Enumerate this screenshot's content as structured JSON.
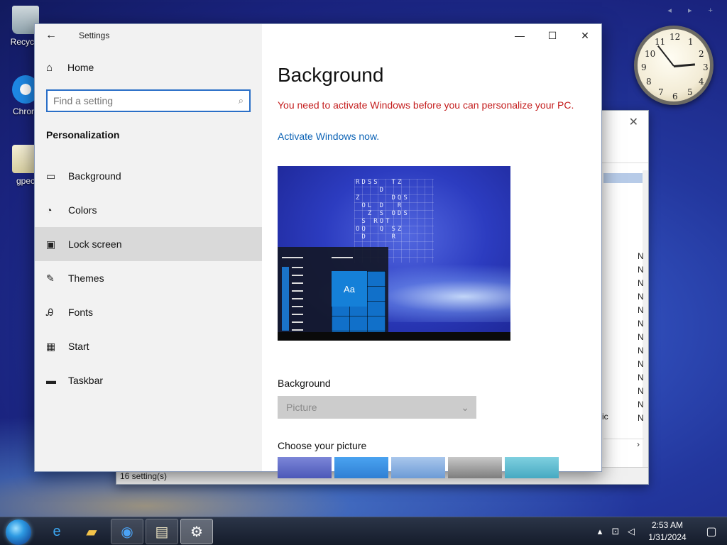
{
  "desktop": {
    "icons": [
      {
        "label": "Recycle",
        "icon": "recycle-bin-icon"
      },
      {
        "label": "Chrom",
        "icon": "chrome-icon"
      },
      {
        "label": "gpec",
        "icon": "document-icon"
      }
    ]
  },
  "background_window": {
    "status": "16 setting(s)",
    "column_letters": [
      "N",
      "N",
      "N",
      "N",
      "N",
      "N",
      "N",
      "N",
      "N",
      "N",
      "N",
      "N",
      "N"
    ],
    "partial_text": "ic"
  },
  "clock_gadget": {
    "numbers": [
      "12",
      "1",
      "2",
      "3",
      "4",
      "5",
      "6",
      "7",
      "8",
      "9",
      "10",
      "11"
    ]
  },
  "settings": {
    "window_title": "Settings",
    "home_label": "Home",
    "search": {
      "placeholder": "Find a setting",
      "value": ""
    },
    "section_title": "Personalization",
    "nav_items": [
      {
        "label": "Background",
        "icon": "picture-icon"
      },
      {
        "label": "Colors",
        "icon": "palette-icon"
      },
      {
        "label": "Lock screen",
        "icon": "lock-screen-icon"
      },
      {
        "label": "Themes",
        "icon": "themes-icon"
      },
      {
        "label": "Fonts",
        "icon": "fonts-icon"
      },
      {
        "label": "Start",
        "icon": "start-icon"
      },
      {
        "label": "Taskbar",
        "icon": "taskbar-icon"
      }
    ],
    "hovered_item": "Lock screen",
    "page_title": "Background",
    "warning": "You need to activate Windows before you can personalize your PC.",
    "activate_link": "Activate Windows now.",
    "preview_tile_text": "Aa",
    "background_label": "Background",
    "background_value": "Picture",
    "choose_label": "Choose your picture"
  },
  "taskbar": {
    "time": "2:53 AM",
    "date": "1/31/2024",
    "apps": [
      "internet-explorer-icon",
      "file-explorer-icon",
      "chrome-icon",
      "notepad-icon",
      "settings-gear-icon"
    ]
  },
  "colors": {
    "accent": "#0b62b5",
    "warning": "#c41e1e",
    "search_border": "#2a6fc7"
  }
}
